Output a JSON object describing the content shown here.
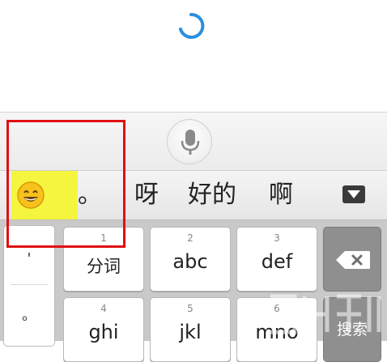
{
  "colors": {
    "spinner": "#2a8fe0",
    "emoji_highlight": "#f5f540",
    "annotation_border": "#e01010",
    "function_key": "#8f8f8f"
  },
  "voice_bar": {
    "icon": "microphone-icon"
  },
  "candidate_bar": {
    "emoji_icon": "smiling-face-icon",
    "candidates": [
      "。",
      "呀",
      "好的",
      "啊"
    ],
    "collapse_icon": "triangle-down-icon"
  },
  "keyboard": {
    "side_column": [
      "'",
      "。"
    ],
    "keys": [
      {
        "number": "1",
        "label": "分词"
      },
      {
        "number": "2",
        "label": "abc"
      },
      {
        "number": "3",
        "label": "def"
      },
      {
        "number": "4",
        "label": "ghi"
      },
      {
        "number": "5",
        "label": "jkl"
      },
      {
        "number": "6",
        "label": "mno"
      }
    ],
    "backspace_icon": "backspace-icon",
    "search_label": "搜索"
  }
}
